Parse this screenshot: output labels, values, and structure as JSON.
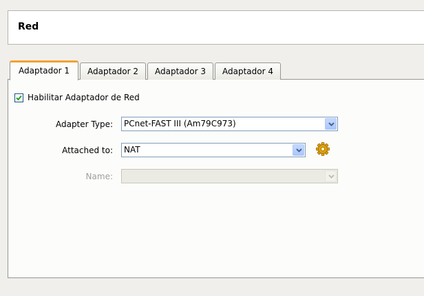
{
  "header": {
    "title": "Red"
  },
  "tabs": [
    {
      "label": "Adaptador 1",
      "active": true
    },
    {
      "label": "Adaptador 2",
      "active": false
    },
    {
      "label": "Adaptador 3",
      "active": false
    },
    {
      "label": "Adaptador 4",
      "active": false
    }
  ],
  "enable_adapter": {
    "label": "Habilitar Adaptador de Red",
    "checked": true
  },
  "adapter_type": {
    "label": "Adapter Type:",
    "value": "PCnet-FAST III (Am79C973)"
  },
  "attached_to": {
    "label": "Attached to:",
    "value": "NAT"
  },
  "name": {
    "label": "Name:",
    "value": "",
    "enabled": false
  },
  "icons": {
    "checkbox_check": "check-icon",
    "dropdown_arrow": "chevron-down-icon",
    "settings": "gear-icon"
  },
  "colors": {
    "active_tab_accent": "#f3a230",
    "check_mark": "#21a121",
    "gear": "#e0a10a"
  }
}
